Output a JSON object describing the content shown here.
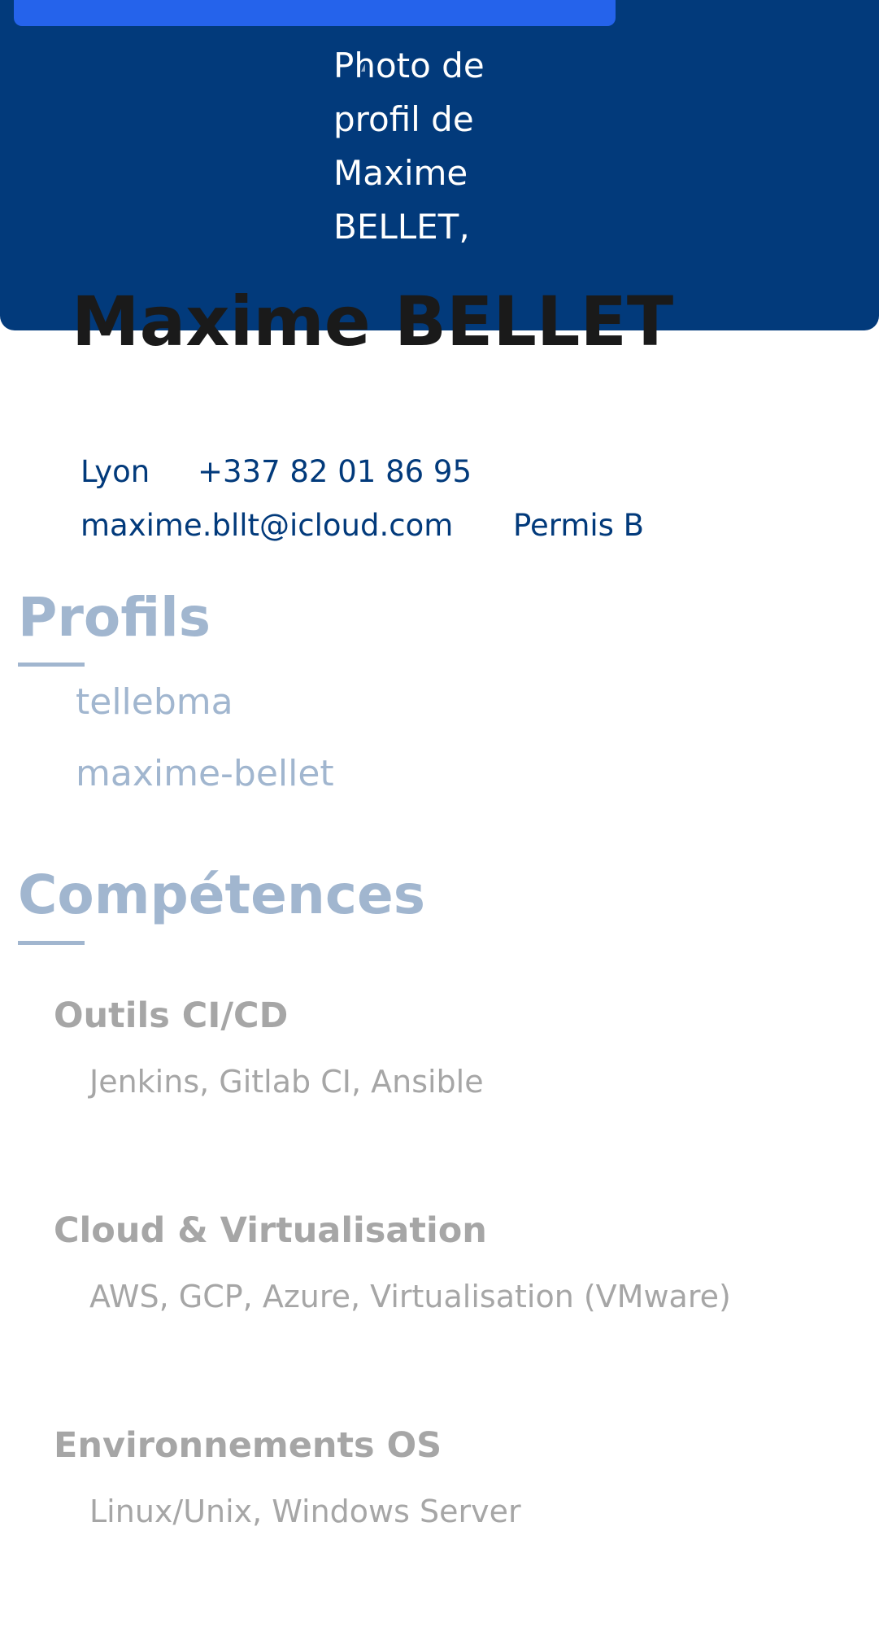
{
  "header": {
    "photo_alt": "Photo de\nprofil de\nMaxime\nBELLET,",
    "name": "Maxime BELLET"
  },
  "contact": {
    "city": "Lyon",
    "phone": "+337 82 01 86 95",
    "email": "maxime.bllt@icloud.com",
    "license": "Permis B"
  },
  "profiles": {
    "title": "Profils",
    "items": [
      "tellebma",
      "maxime-bellet"
    ]
  },
  "skills": {
    "title": "Compétences",
    "groups": [
      {
        "name": "Outils CI/CD",
        "value": "Jenkins, Gitlab CI, Ansible"
      },
      {
        "name": "Cloud & Virtualisation",
        "value": "AWS, GCP, Azure, Virtualisation (VMware)"
      },
      {
        "name": "Environnements OS",
        "value": "Linux/Unix, Windows Server"
      }
    ]
  },
  "colors": {
    "header_bg": "#023a7b",
    "top_button": "#2563eb",
    "muted_blue": "#a1b6cf",
    "muted_gray": "#a6a6a6"
  }
}
